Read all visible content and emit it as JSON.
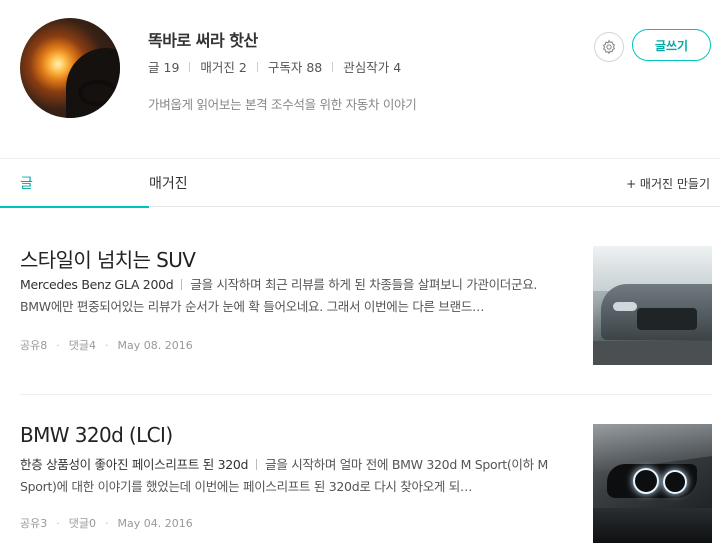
{
  "profile": {
    "name": "똑바로 써라 핫산",
    "stats": [
      {
        "label": "글",
        "value": "19"
      },
      {
        "label": "매거진",
        "value": "2"
      },
      {
        "label": "구독자",
        "value": "88"
      },
      {
        "label": "관심작가",
        "value": "4"
      }
    ],
    "bio": "가벼웁게 읽어보는 본격 조수석을 위한 자동차 이야기",
    "write_label": "글쓰기",
    "settings_icon": "gear-icon"
  },
  "tabs": {
    "posts": "글",
    "magazine": "매거진",
    "make_magazine": "+ 매거진 만들기",
    "active": "posts",
    "accent_color": "#00c3bd"
  },
  "posts": [
    {
      "title": "스타일이 넘치는 SUV",
      "subtitle": "Mercedes Benz GLA 200d",
      "excerpt": "글을 시작하며 최근 리뷰를 하게 된 차종들을 살펴보니 가관이더군요. BMW에만 편중되어있는 리뷰가 순서가 눈에 확 들어오네요. 그래서 이번에는 다른 브랜드…",
      "shares": "공유8",
      "comments": "댓글4",
      "date": "May 08. 2016"
    },
    {
      "title": "BMW 320d (LCI)",
      "subtitle": "한층 상품성이 좋아진 페이스리프트 된 320d",
      "excerpt": "글을 시작하며 얼마 전에 BMW 320d M Sport(이하 M Sport)에 대한 이야기를 했었는데 이번에는 페이스리프트 된 320d로 다시 찾아오게 되…",
      "shares": "공유3",
      "comments": "댓글0",
      "date": "May 04. 2016"
    }
  ]
}
